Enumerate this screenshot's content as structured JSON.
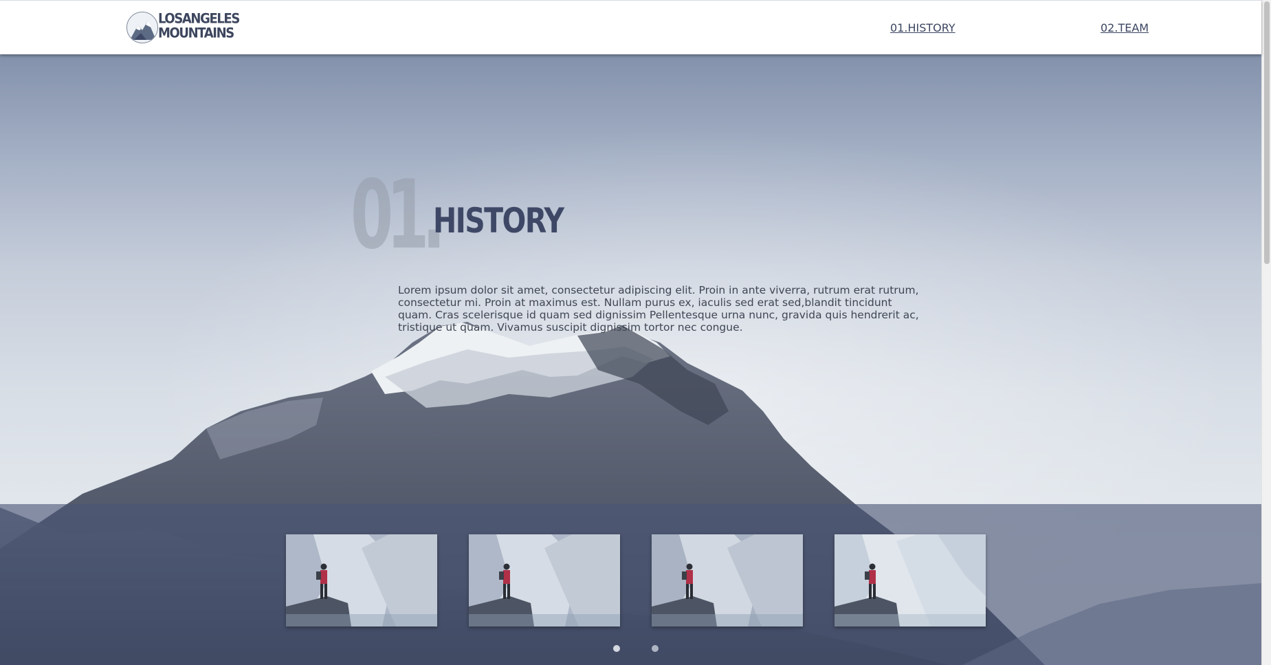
{
  "header": {
    "logo_line1": "LOSANGELES",
    "logo_line2": "MOUNTAINS",
    "nav": [
      {
        "label": "01.HISTORY"
      },
      {
        "label": "02.TEAM"
      }
    ]
  },
  "section": {
    "number": "01.",
    "title": "HISTORY",
    "body": "Lorem ipsum dolor sit amet, consectetur adipiscing elit. Proin in ante viverra, rutrum erat rutrum, consectetur mi. Proin at maximus est. Nullam purus ex, iaculis sed erat sed,blandit tincidunt quam. Cras scelerisque id quam sed dignissim Pellentesque urna nunc, gravida quis hendrerit ac, tristique ut quam. Vivamus suscipit dignissim tortor nec congue."
  },
  "gallery": {
    "thumbnails": 4,
    "active_page": 1,
    "pages": 2
  },
  "colors": {
    "header_bg": "#ffffff",
    "nav_text": "#3b4560",
    "title_text": "#3e4866",
    "band": "#4a5676"
  }
}
